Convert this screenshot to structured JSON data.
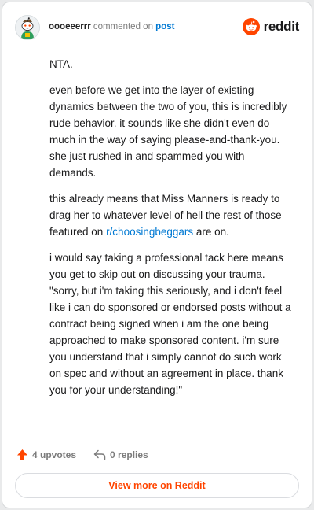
{
  "header": {
    "username": "oooeeerrr",
    "action_text": "commented on",
    "post_link": "post",
    "brand": "reddit",
    "avatar_icon": "snoo-avatar-icon",
    "brand_icon": "reddit-logo-icon"
  },
  "comment": {
    "paragraphs": {
      "p1": "NTA.",
      "p2": "even before we get into the layer of existing dynamics between the two of you, this is incredibly rude behavior. it sounds like she didn't even do much in the way of saying please-and-thank-you. she just rushed in and spammed you with demands.",
      "p3_before": "this already means that Miss Manners is ready to drag her to whatever level of hell the rest of those featured on ",
      "p3_link": "r/choosingbeggars",
      "p3_after": " are on.",
      "p4": "i would say taking a professional tack here means you get to skip out on discussing your trauma. \"sorry, but i'm taking this seriously, and i don't feel like i can do sponsored or endorsed posts without a contract being signed when i am the one being approached to make sponsored content. i'm sure you understand that i simply cannot do such work on spec and without an agreement in place. thank you for your understanding!\""
    }
  },
  "actions": {
    "upvotes": "4 upvotes",
    "replies": "0 replies",
    "upvote_icon": "upvote-arrow-icon",
    "reply_icon": "reply-arrow-icon"
  },
  "footer": {
    "view_more": "View more on Reddit"
  },
  "colors": {
    "brand_orange": "#ff4500",
    "link_blue": "#0079d3",
    "muted_text": "#7c7c7c"
  }
}
